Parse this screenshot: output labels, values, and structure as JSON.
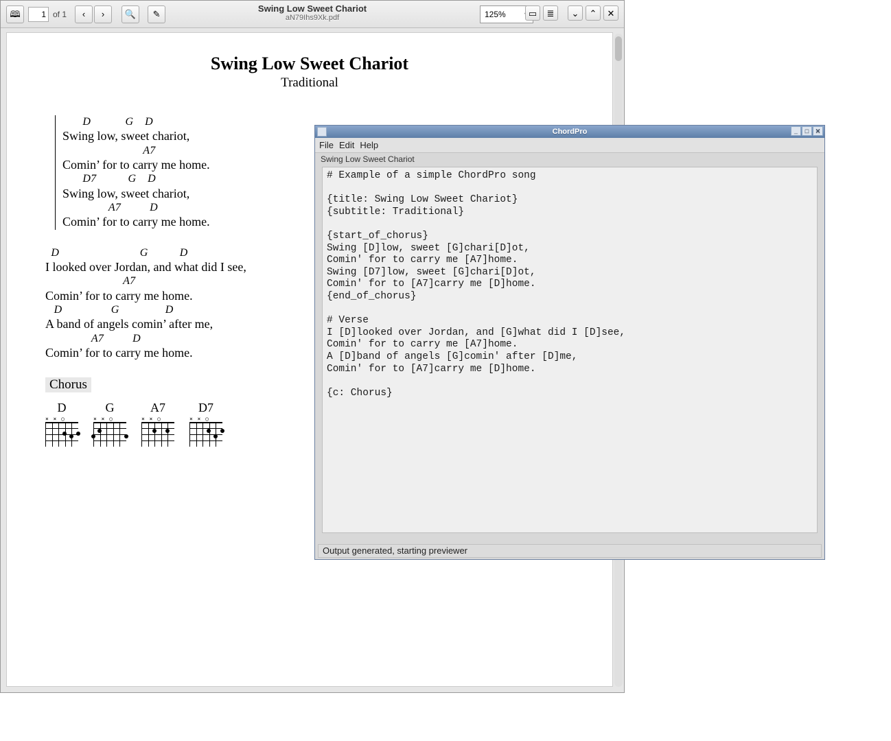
{
  "pdf": {
    "page_current": "1",
    "page_of": "of 1",
    "title": "Swing Low Sweet Chariot",
    "filename": "aN79Ihs9Xk.pdf",
    "zoom": "125%"
  },
  "song": {
    "title": "Swing Low Sweet Chariot",
    "subtitle": "Traditional",
    "chorus": [
      {
        "chords": "       D            G    D",
        "lyric": "Swing low, sweet chariot,"
      },
      {
        "chords": "                            A7",
        "lyric": "Comin’ for to carry me home."
      },
      {
        "chords": "       D7           G    D",
        "lyric": "Swing low, sweet chariot,"
      },
      {
        "chords": "                A7          D",
        "lyric": "Comin’ for to carry me home."
      }
    ],
    "verse": [
      {
        "chords": "  D                            G           D",
        "lyric": "I looked over Jordan, and what did I see,"
      },
      {
        "chords": "                           A7",
        "lyric": "Comin’ for to carry me home."
      },
      {
        "chords": "   D                 G                D",
        "lyric": "A band of angels comin’ after me,"
      },
      {
        "chords": "                A7          D",
        "lyric": "Comin’ for to carry me home."
      }
    ],
    "chorus_label": "Chorus",
    "diagrams": [
      "D",
      "G",
      "A7",
      "D7"
    ]
  },
  "editor": {
    "app_title": "ChordPro",
    "menu": {
      "file": "File",
      "edit": "Edit",
      "help": "Help"
    },
    "tab": "Swing Low Sweet Chariot",
    "status": "Output generated, starting previewer",
    "source": [
      "# Example of a simple ChordPro song",
      "",
      "{title: Swing Low Sweet Chariot}",
      "{subtitle: Traditional}",
      "",
      "{start_of_chorus}",
      "Swing [D]low, sweet [G]chari[D]ot,",
      "Comin' for to carry me [A7]home.",
      "Swing [D7]low, sweet [G]chari[D]ot,",
      "Comin' for to [A7]carry me [D]home.",
      "{end_of_chorus}",
      "",
      "# Verse",
      "I [D]looked over Jordan, and [G]what did I [D]see,",
      "Comin' for to carry me [A7]home.",
      "A [D]band of angels [G]comin' after [D]me,",
      "Comin' for to [A7]carry me [D]home.",
      "",
      "{c: Chorus}"
    ]
  }
}
